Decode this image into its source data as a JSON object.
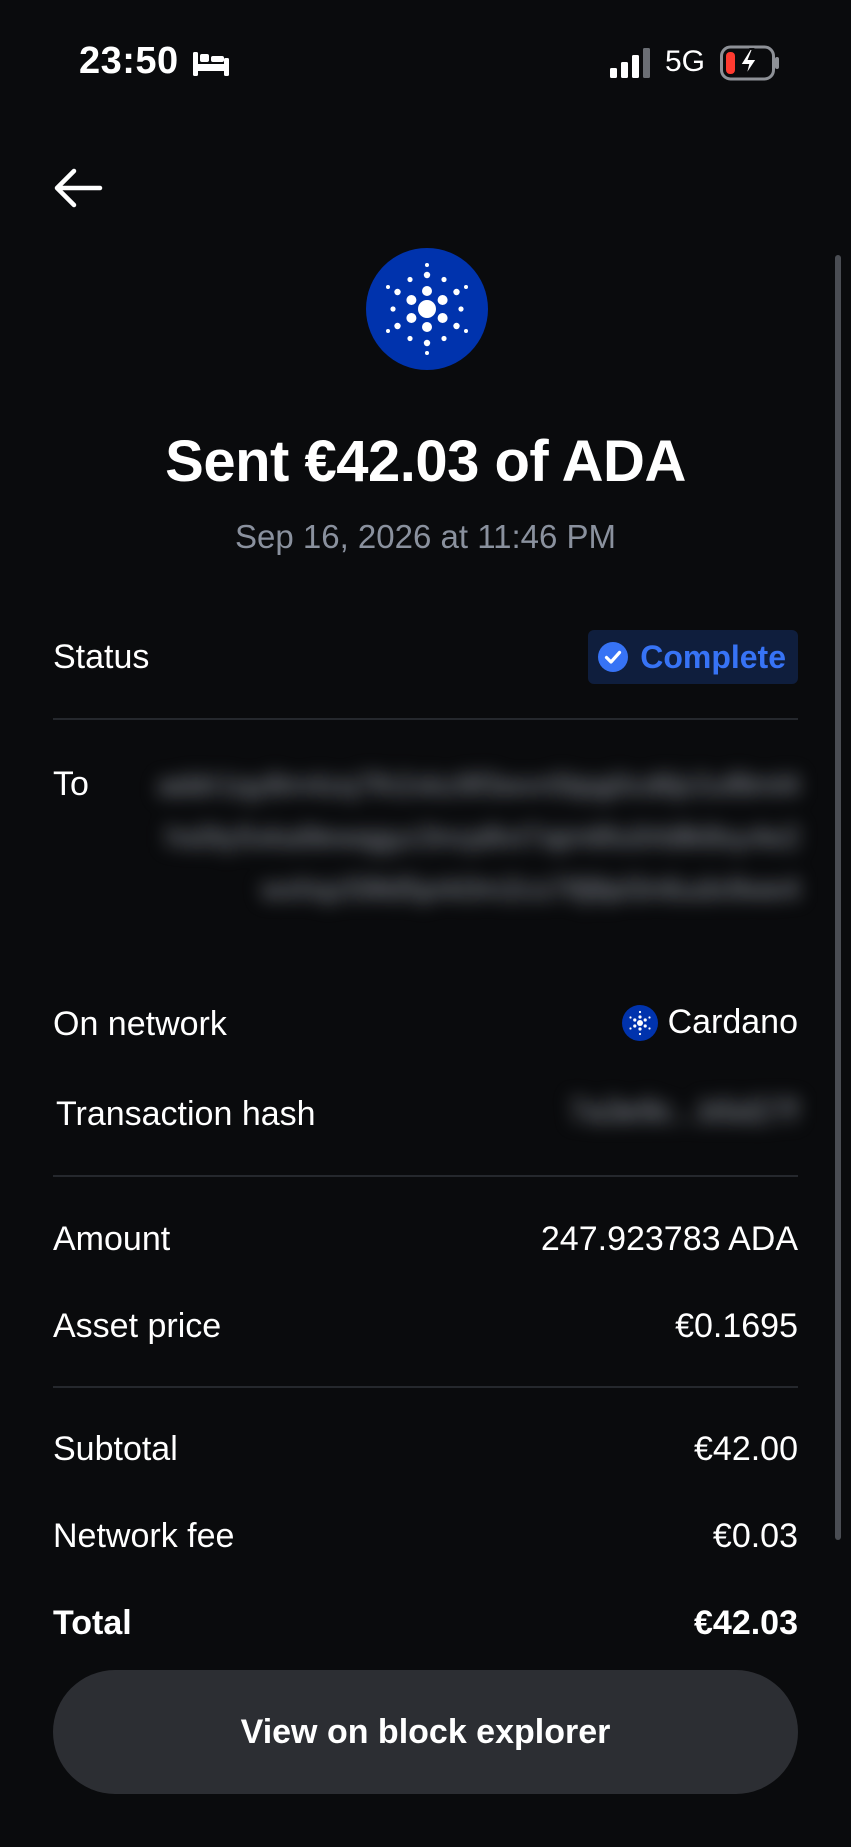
{
  "status_bar": {
    "time": "23:50",
    "network": "5G",
    "icons": [
      "bed-icon",
      "signal-icon",
      "battery-charging-icon"
    ]
  },
  "header": {
    "back_icon": "back-arrow-icon",
    "coin_icon": "cardano-logo-icon",
    "title": "Sent €42.03 of ADA",
    "date": "Sep 16, 2026 at 11:46 PM"
  },
  "details": {
    "status_label": "Status",
    "status_value": "Complete",
    "to_label": "To",
    "to_value": "addr1qy8m4zq7lh2xkz9f3wvn5tpg0cd6jr2uf8ml4hs0ty5xka9ewqgyz3ncp8vt7ajm6fu0rldlk8sy4e2wxhqz59ld5prk0m2cs7tfj8pl3n6udx9we4",
    "network_label": "On network",
    "network_value": "Cardano",
    "hash_label": "Transaction hash",
    "hash_value": "7a3e9c...b5d27f"
  },
  "amounts": {
    "amount_label": "Amount",
    "amount_value": "247.923783 ADA",
    "price_label": "Asset price",
    "price_value": "€0.1695"
  },
  "totals": {
    "subtotal_label": "Subtotal",
    "subtotal_value": "€42.00",
    "fee_label": "Network fee",
    "fee_value": "€0.03",
    "total_label": "Total",
    "total_value": "€42.03"
  },
  "actions": {
    "explorer_label": "View on block explorer"
  },
  "colors": {
    "background": "#0a0b0d",
    "accent": "#3773f5",
    "cardano_blue": "#0033ad",
    "muted_text": "#8a919e",
    "button_bg": "#2c2e33"
  }
}
